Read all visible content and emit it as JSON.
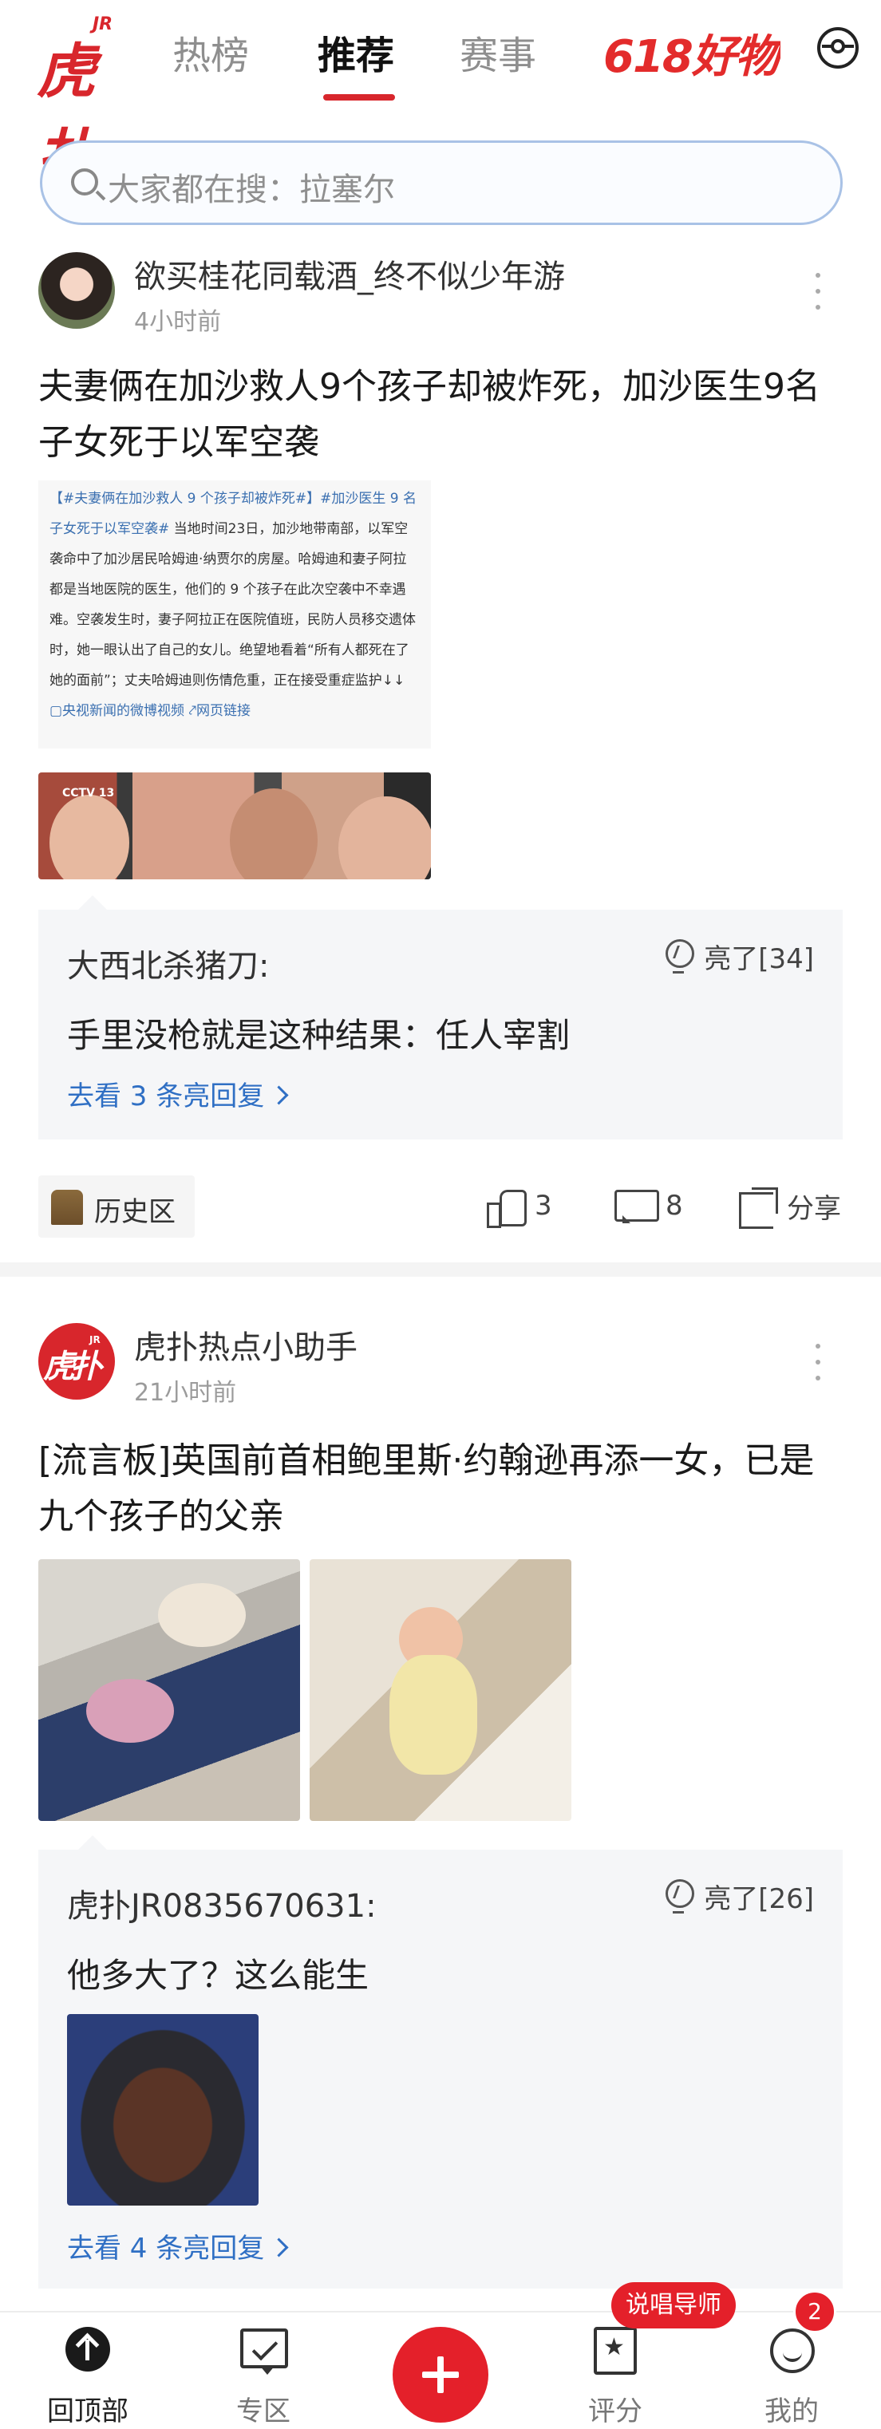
{
  "nav": {
    "logo_text": "虎扑",
    "logo_jr": "JR",
    "tabs": [
      {
        "label": "热榜",
        "active": false
      },
      {
        "label": "推荐",
        "active": true
      },
      {
        "label": "赛事",
        "active": false
      },
      {
        "label": "618好物",
        "active": false
      }
    ]
  },
  "search": {
    "placeholder": "大家都在搜：拉塞尔"
  },
  "posts": [
    {
      "username": "欲买桂花同载酒_终不似少年游",
      "time": "4小时前",
      "title": "夫妻俩在加沙救人9个孩子却被炸死，加沙医生9名子女死于以军空袭",
      "embedded_text": {
        "hashtag": "【#夫妻俩在加沙救人 9 个孩子却被炸死#",
        "hashtag2": "】#加沙医生 9 名子女死于以军空袭#",
        "body": " 当地时间23日，加沙地带南部，以军空袭命中了加沙居民哈姆迪·纳贾尔的房屋。哈姆迪和妻子阿拉都是当地医院的医生，他们的 9 个孩子在此次空袭中不幸遇难。空袭发生时，妻子阿拉正在医院值班，民防人员移交遗体时，她一眼认出了自己的女儿。绝望地看着“所有人都死在了她的面前”；丈夫哈姆迪则伤情危重，正在接受重症监护↓↓ ",
        "links": "▢央视新闻的微博视频 ⤤网页链接"
      },
      "video_label": "CCTV 13",
      "comment": {
        "author": "大西北杀猪刀:",
        "text": "手里没枪就是这种结果：任人宰割",
        "light": "亮了[34]",
        "more": "去看 3 条亮回复"
      },
      "tag": "历史区",
      "likes": "3",
      "comments": "8",
      "share": "分享"
    },
    {
      "username": "虎扑热点小助手",
      "time": "21小时前",
      "title": "[流言板]英国前首相鲍里斯·约翰逊再添一女，已是九个孩子的父亲",
      "comment": {
        "author": "虎扑JR0835670631:",
        "text": "他多大了？这么能生",
        "light": "亮了[26]",
        "more": "去看 4 条亮回复"
      }
    }
  ],
  "bottom_bar": {
    "items": [
      "回顶部",
      "专区",
      "评分",
      "我的"
    ],
    "bubble": "说唱导师",
    "badge": "2"
  },
  "colors": {
    "brand": "#d8262c",
    "link": "#2f6fc4",
    "search_border": "#a9c2e6"
  }
}
